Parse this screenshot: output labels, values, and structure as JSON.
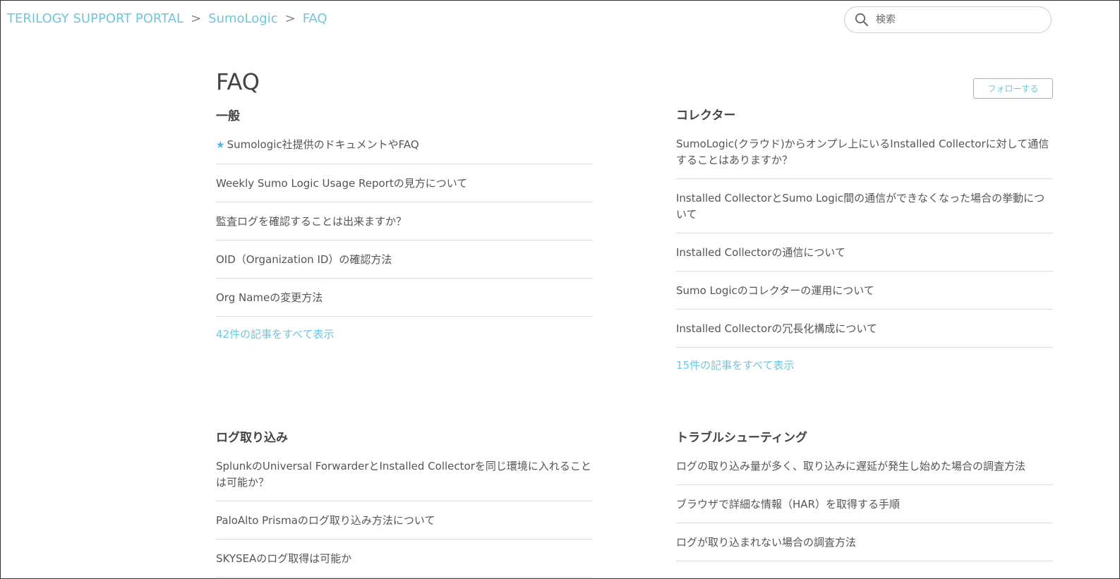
{
  "breadcrumb": {
    "items": [
      "TERILOGY SUPPORT PORTAL",
      "SumoLogic",
      "FAQ"
    ],
    "separator": ">"
  },
  "search": {
    "placeholder": "検索",
    "icon": "search-icon"
  },
  "page": {
    "title": "FAQ",
    "follow_label": "フォローする"
  },
  "colors": {
    "accent": "#6ec6dc",
    "star": "#4fb3d9",
    "text": "#555555",
    "divider": "#dddddd"
  },
  "sections": [
    {
      "title": "一般",
      "articles": [
        {
          "title": "Sumologic社提供のドキュメントやFAQ",
          "promoted": true
        },
        {
          "title": "Weekly Sumo Logic Usage Reportの見方について"
        },
        {
          "title": "監査ログを確認することは出来ますか？"
        },
        {
          "title": "OID（Organization ID）の確認方法"
        },
        {
          "title": "Org Nameの変更方法"
        }
      ],
      "see_all": "42件の記事をすべて表示"
    },
    {
      "title": "コレクター",
      "articles": [
        {
          "title": "SumoLogic(クラウド)からオンプレ上にいるInstalled Collectorに対して通信することはありますか？"
        },
        {
          "title": "Installed CollectorとSumo Logic間の通信ができなくなった場合の挙動について"
        },
        {
          "title": "Installed Collectorの通信について"
        },
        {
          "title": "Sumo Logicのコレクターの運用について"
        },
        {
          "title": "Installed Collectorの冗長化構成について"
        }
      ],
      "see_all": "15件の記事をすべて表示"
    },
    {
      "title": "ログ取り込み",
      "articles": [
        {
          "title": "SplunkのUniversal ForwarderとInstalled Collectorを同じ環境に入れることは可能か？"
        },
        {
          "title": "PaloAlto Prismaのログ取り込み方法について"
        },
        {
          "title": "SKYSEAのログ取得は可能か"
        }
      ]
    },
    {
      "title": "トラブルシューティング",
      "articles": [
        {
          "title": "ログの取り込み量が多く、取り込みに遅延が発生し始めた場合の調査方法"
        },
        {
          "title": "ブラウザで詳細な情報（HAR）を取得する手順"
        },
        {
          "title": "ログが取り込まれない場合の調査方法"
        }
      ]
    }
  ]
}
